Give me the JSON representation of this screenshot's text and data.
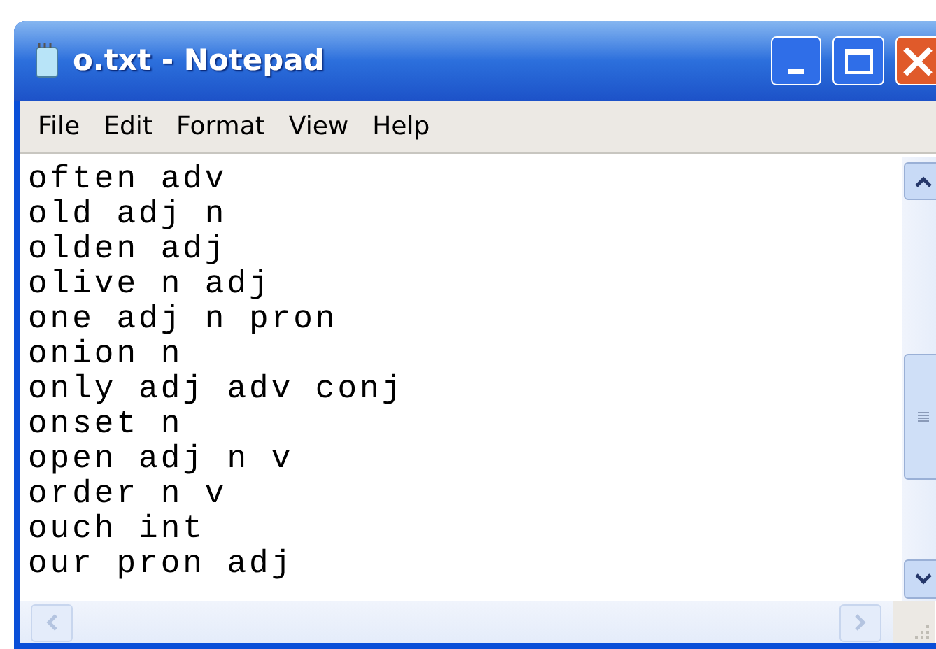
{
  "window": {
    "title": "o.txt - Notepad"
  },
  "menu": [
    "File",
    "Edit",
    "Format",
    "View",
    "Help"
  ],
  "lines": [
    "often adv",
    "old adj n",
    "olden adj",
    "olive n adj",
    "one adj n pron",
    "onion n",
    "only adj adv conj",
    "onset n",
    "open adj n v",
    "order n v",
    "ouch int",
    "our pron adj"
  ]
}
